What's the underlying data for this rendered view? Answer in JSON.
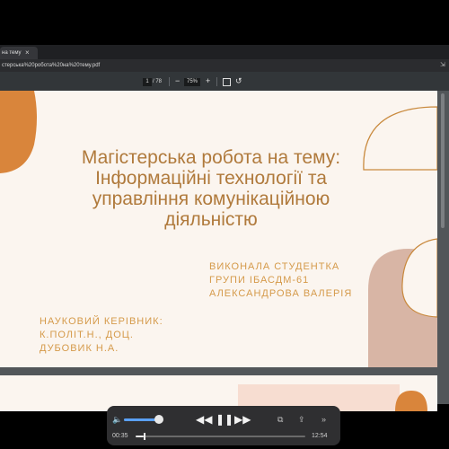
{
  "browser": {
    "tab_title": "на тему",
    "tab_close": "×",
    "url": "стерська%20робота%20на%20тему.pdf",
    "url_icon": "⇲"
  },
  "pdf_toolbar": {
    "page_current": "1",
    "page_total": "/ 78",
    "zoom_out": "−",
    "zoom_value": "75%",
    "zoom_in": "+"
  },
  "slide": {
    "title_line1": "Магістерська робота на тему:",
    "title_line2": "Інформаційні технології та",
    "title_line3": "управління комунікаційною",
    "title_line4": "діяльністю",
    "student_line1": "ВИКОНАЛА СТУДЕНТКА",
    "student_line2": "ГРУПИ ІБАСДМ-61",
    "student_line3": "АЛЕКСАНДРОВА ВАЛЕРІЯ",
    "advisor_line1": "НАУКОВИЙ КЕРІВНИК:",
    "advisor_line2": "К.ПОЛІТ.Н., ДОЦ.",
    "advisor_line3": "ДУБОВИК Н.А."
  },
  "colors": {
    "accent_orange": "#d9853b",
    "title_brown": "#b07a3c",
    "text_gold": "#d59a4a",
    "shape_rose": "#d8b5a5"
  },
  "player": {
    "volume_icon": "speaker-icon",
    "volume_level": 0.88,
    "rewind": "◀◀",
    "pause": "❚❚",
    "forward": "▶▶",
    "pip_icon": "pip-icon",
    "share_icon": "share-icon",
    "more_icon": "»",
    "elapsed": "00:35",
    "total": "12:54",
    "progress": 0.045
  }
}
